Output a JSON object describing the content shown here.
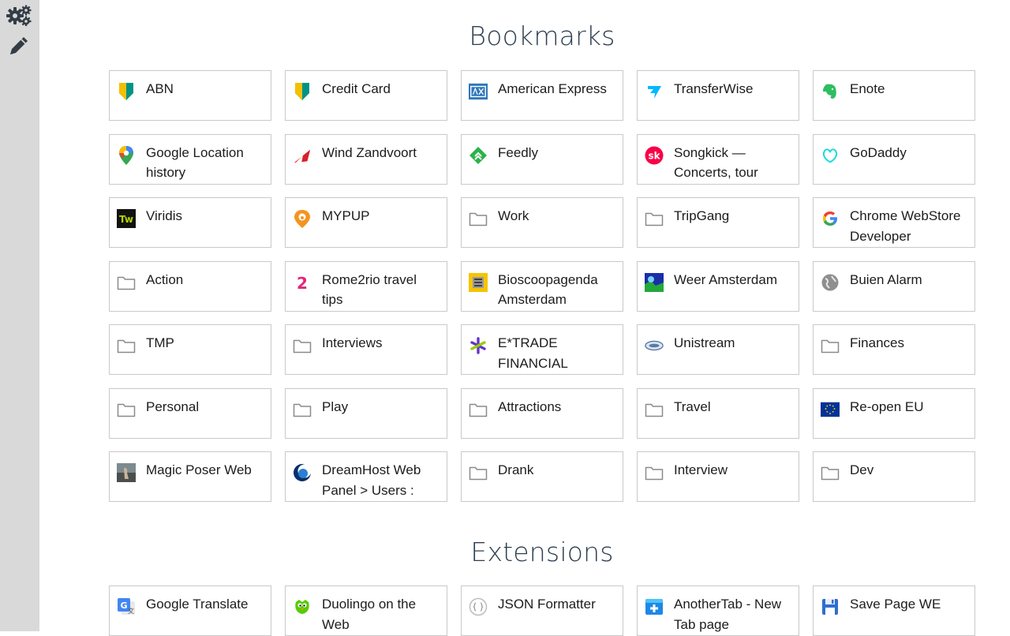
{
  "sidebar": {
    "settings_icon": "gears-icon",
    "edit_icon": "pencil-icon"
  },
  "sections": {
    "bookmarks_title": "Bookmarks",
    "extensions_title": "Extensions"
  },
  "bookmarks": [
    {
      "label": "ABN",
      "icon": "abn-icon"
    },
    {
      "label": "Credit Card",
      "icon": "abn-icon"
    },
    {
      "label": "American Express",
      "icon": "amex-icon"
    },
    {
      "label": "TransferWise",
      "icon": "transferwise-icon"
    },
    {
      "label": "Enote",
      "icon": "evernote-icon"
    },
    {
      "label": "Google Location history",
      "icon": "maps-pin-icon"
    },
    {
      "label": "Wind Zandvoort",
      "icon": "windsurf-icon"
    },
    {
      "label": "Feedly",
      "icon": "feedly-icon"
    },
    {
      "label": "Songkick — Concerts, tour",
      "icon": "songkick-icon"
    },
    {
      "label": "GoDaddy",
      "icon": "godaddy-icon"
    },
    {
      "label": "Viridis",
      "icon": "tw-icon"
    },
    {
      "label": "MYPUP",
      "icon": "mypup-icon"
    },
    {
      "label": "Work",
      "icon": "folder-icon"
    },
    {
      "label": "TripGang",
      "icon": "folder-icon"
    },
    {
      "label": "Chrome WebStore Developer",
      "icon": "google-icon"
    },
    {
      "label": "Action",
      "icon": "folder-icon"
    },
    {
      "label": "Rome2rio travel tips",
      "icon": "rome2rio-icon"
    },
    {
      "label": "Bioscoopagenda Amsterdam",
      "icon": "bioscoop-icon"
    },
    {
      "label": "Weer Amsterdam",
      "icon": "weather-map-icon"
    },
    {
      "label": "Buien Alarm",
      "icon": "globe-icon"
    },
    {
      "label": "TMP",
      "icon": "folder-icon"
    },
    {
      "label": "Interviews",
      "icon": "folder-icon"
    },
    {
      "label": "E*TRADE FINANCIAL",
      "icon": "etrade-icon"
    },
    {
      "label": "Unistream",
      "icon": "unistream-icon"
    },
    {
      "label": "Finances",
      "icon": "folder-icon"
    },
    {
      "label": "Personal",
      "icon": "folder-icon"
    },
    {
      "label": "Play",
      "icon": "folder-icon"
    },
    {
      "label": "Attractions",
      "icon": "folder-icon"
    },
    {
      "label": "Travel",
      "icon": "folder-icon"
    },
    {
      "label": "Re-open EU",
      "icon": "eu-flag-icon"
    },
    {
      "label": "Magic Poser Web",
      "icon": "photo-icon"
    },
    {
      "label": "DreamHost Web Panel > Users :",
      "icon": "dreamhost-icon"
    },
    {
      "label": "Drank",
      "icon": "folder-icon"
    },
    {
      "label": "Interview",
      "icon": "folder-icon"
    },
    {
      "label": "Dev",
      "icon": "folder-icon"
    }
  ],
  "extensions": [
    {
      "label": "Google Translate",
      "icon": "google-translate-icon"
    },
    {
      "label": "Duolingo on the Web",
      "icon": "duolingo-icon"
    },
    {
      "label": "JSON Formatter",
      "icon": "json-icon"
    },
    {
      "label": "AnotherTab - New Tab page",
      "icon": "anothertab-icon"
    },
    {
      "label": "Save Page WE",
      "icon": "floppy-icon"
    }
  ],
  "colors": {
    "sidebar_bg": "#d9d9d9",
    "heading": "#2d3e50",
    "tile_border": "#c9c9c9",
    "folder": "#8a8a8a"
  }
}
